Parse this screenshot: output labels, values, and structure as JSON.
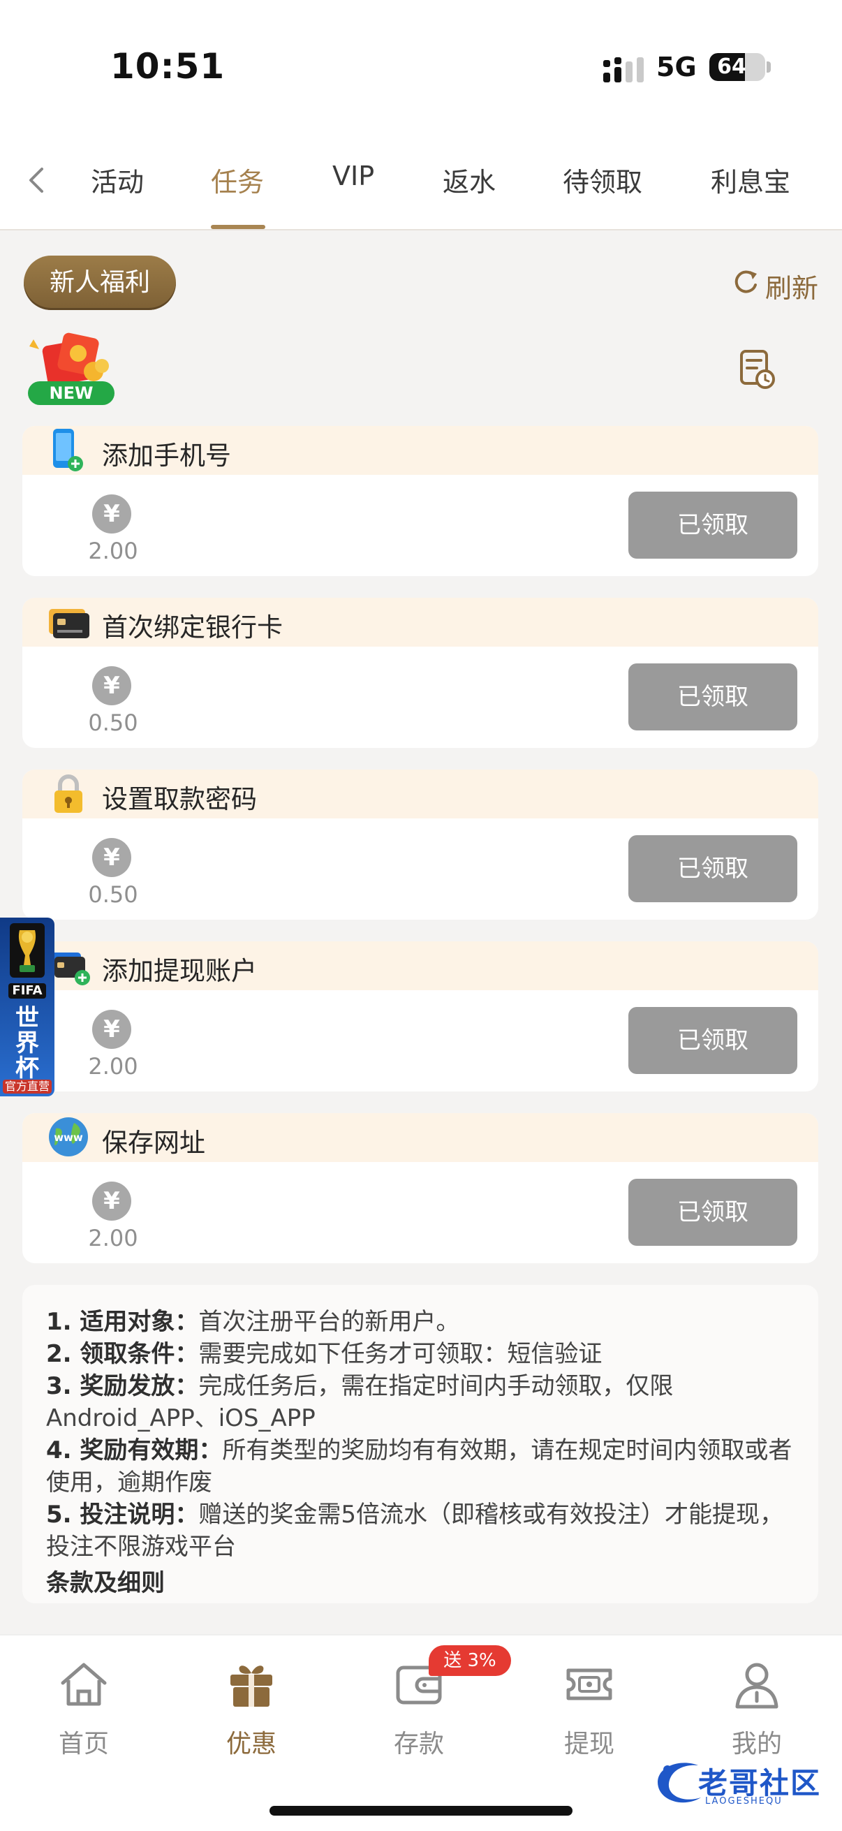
{
  "status_bar": {
    "time": "10:51",
    "network": "5G",
    "battery_level": 64,
    "battery_text": "64"
  },
  "tabs": {
    "items": [
      {
        "label": "活动"
      },
      {
        "label": "任务"
      },
      {
        "label": "VIP"
      },
      {
        "label": "返水"
      },
      {
        "label": "待领取"
      },
      {
        "label": "利息宝"
      }
    ],
    "active": "任务"
  },
  "header": {
    "category_label": "新人福利",
    "refresh_label": "刷新",
    "new_tag": "NEW"
  },
  "tasks": [
    {
      "title": "添加手机号",
      "currency_symbol": "¥",
      "amount": "2.00",
      "button": "已领取",
      "icon": "phone-add-icon"
    },
    {
      "title": "首次绑定银行卡",
      "currency_symbol": "¥",
      "amount": "0.50",
      "button": "已领取",
      "icon": "bank-card-icon"
    },
    {
      "title": "设置取款密码",
      "currency_symbol": "¥",
      "amount": "0.50",
      "button": "已领取",
      "icon": "lock-icon"
    },
    {
      "title": "添加提现账户",
      "currency_symbol": "¥",
      "amount": "2.00",
      "button": "已领取",
      "icon": "card-add-icon"
    },
    {
      "title": "保存网址",
      "currency_symbol": "¥",
      "amount": "2.00",
      "button": "已领取",
      "icon": "globe-icon"
    }
  ],
  "rules": [
    {
      "label": "1. 适用对象：",
      "text": "首次注册平台的新用户。"
    },
    {
      "label": "2. 领取条件：",
      "text": "需要完成如下任务才可领取：短信验证"
    },
    {
      "label": "3. 奖励发放：",
      "text": "完成任务后，需在指定时间内手动领取，仅限Android_APP、iOS_APP"
    },
    {
      "label": "4. 奖励有效期：",
      "text": "所有类型的奖励均有有效期，请在规定时间内领取或者使用，逾期作废"
    },
    {
      "label": "5. 投注说明：",
      "text": "赠送的奖金需5倍流水（即稽核或有效投注）才能提现，投注不限游戏平台"
    }
  ],
  "terms_label": "条款及细则",
  "floating_badge": {
    "logo": "FIFA",
    "title": "世界杯",
    "subtitle": "官方直营"
  },
  "bottom_nav": {
    "items": [
      {
        "label": "首页"
      },
      {
        "label": "优惠"
      },
      {
        "label": "存款"
      },
      {
        "label": "提现"
      },
      {
        "label": "我的"
      }
    ],
    "active": "优惠",
    "deposit_badge": "送 3%"
  },
  "watermark": {
    "text": "老哥社区",
    "sub": "LAOGESHEQU"
  },
  "colors": {
    "accent": "#a5814e",
    "pill": "#8b6c3d",
    "card_head": "#fdf3e6",
    "button_disabled": "#9a9a9a",
    "badge": "#e53a32"
  }
}
